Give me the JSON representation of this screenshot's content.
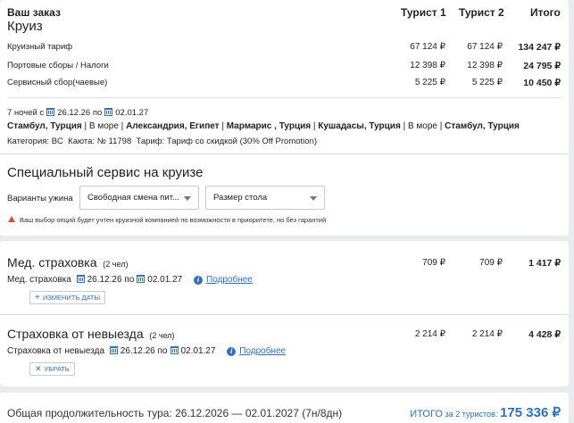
{
  "order": {
    "title": "Ваш заказ",
    "subtitle": "Круиз",
    "columns": [
      "Турист 1",
      "Турист 2",
      "Итого"
    ],
    "rows": [
      {
        "label": "Круизный тариф",
        "t1": "67 124 ₽",
        "t2": "67 124 ₽",
        "total": "134 247 ₽"
      },
      {
        "label": "Портовые сборы / Налоги",
        "t1": "12 398 ₽",
        "t2": "12 398 ₽",
        "total": "24 795 ₽"
      },
      {
        "label": "Сервисный сбор(чаевые)",
        "t1": "5 225 ₽",
        "t2": "5 225 ₽",
        "total": "10 450 ₽"
      }
    ]
  },
  "trip": {
    "nights": "7 ночей с",
    "date_from": "26.12.26",
    "to_word": "по",
    "date_to": "02.01.27",
    "route": [
      {
        "text": "Стамбул, Турция",
        "bold": true
      },
      {
        "text": "В море",
        "bold": false
      },
      {
        "text": "Александрия, Египет",
        "bold": true
      },
      {
        "text": "Мармарис , Турция",
        "bold": true
      },
      {
        "text": "Кушадасы, Турция",
        "bold": true
      },
      {
        "text": "В море",
        "bold": false
      },
      {
        "text": "Стамбул, Турция",
        "bold": true
      }
    ],
    "category_line": "Категория: BC  Каюта: № 11798  Тариф: Тариф со скидкой (30% Off Promotion)"
  },
  "special": {
    "title": "Специальный сервис на круизе",
    "dinner_label": "Варианты ужина",
    "dinner_value": "Свободная смена пит...",
    "table_value": "Размер стола",
    "warning": "Ваш выбор опций будет учтен круизной компанией по возможности в приоритете, но без гарантий"
  },
  "med": {
    "title": "Мед. страховка",
    "count": "(2 чел)",
    "t1": "709 ₽",
    "t2": "709 ₽",
    "total": "1 417 ₽",
    "sub_label": "Мед. страховка",
    "date_from": "26.12.26",
    "to_word": "по",
    "date_to": "02.01.27",
    "more_link": "Подробнее",
    "change_button": "ИЗМЕНИТЬ ДАТЫ",
    "change_icon": "+"
  },
  "cancel": {
    "title": "Страховка от невыезда",
    "count": "(2 чел)",
    "t1": "2 214 ₽",
    "t2": "2 214 ₽",
    "total": "4 428 ₽",
    "sub_label": "Страховка от невыезда",
    "date_from": "26.12.26",
    "to_word": "по",
    "date_to": "02.01.27",
    "more_link": "Подробнее",
    "remove_button": "УБРАТЬ",
    "remove_icon": "✕"
  },
  "total": {
    "duration": "Общая продолжительность тура: 26.12.2026 — 02.01.2027 (7н/8дн)",
    "itogo": "ИТОГО",
    "for_tourists": "за 2 туристов:",
    "sum": "175 336 ₽"
  },
  "colors": {
    "accent": "#2f6fc4",
    "warning": "#e04a3a"
  }
}
